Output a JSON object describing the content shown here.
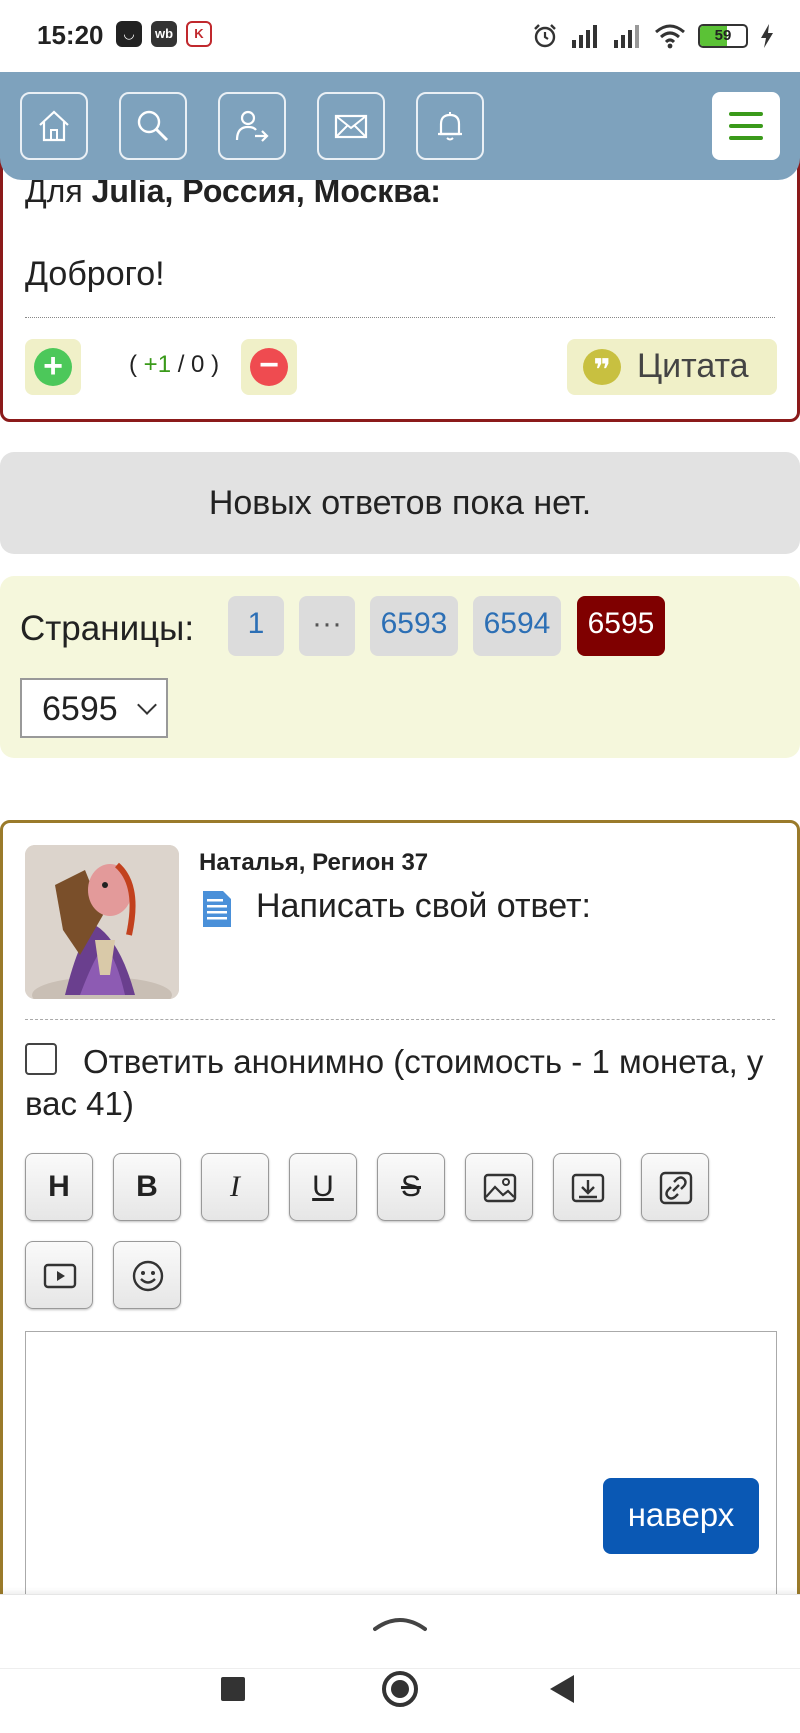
{
  "status_bar": {
    "time": "15:20",
    "app_icons": [
      "wb",
      "K"
    ],
    "battery_level": "59"
  },
  "header": {
    "nav_icons": [
      "home-icon",
      "search-icon",
      "login-icon",
      "mail-icon",
      "bell-icon"
    ],
    "menu_icon": "hamburger-menu-icon"
  },
  "post": {
    "for_prefix": "Для",
    "for_recipient": "Julia, Россия, Москва:",
    "text": "Доброго!",
    "rating_open": "(",
    "rating_plus": "+1",
    "rating_rest": "/ 0 )",
    "quote_label": "Цитата"
  },
  "no_answers": "Новых ответов пока нет.",
  "pagination": {
    "label": "Страницы:",
    "pages": [
      "1",
      "···",
      "6593",
      "6594",
      "6595"
    ],
    "current": "6595",
    "select_value": "6595"
  },
  "reply": {
    "user_name": "Наталья, Регион 37",
    "write_label": "Написать свой ответ:",
    "anonymous_label": "Ответить анонимно (стоимость - 1 монета, у вас 41)",
    "toolbar": {
      "heading": "H",
      "bold": "B",
      "italic": "I",
      "underline": "U",
      "strike": "S",
      "icons": [
        "image-icon",
        "download-icon",
        "link-icon",
        "video-icon",
        "smiley-icon"
      ]
    },
    "editor_value": ""
  },
  "scroll_top_label": "наверх",
  "colors": {
    "header_bg": "#7ea2bd",
    "post_border": "#8b1a1a",
    "reply_border": "#9a7a2a",
    "active_page": "#7f0000",
    "pager_bg": "#f5f7dc",
    "top_button": "#0a58b4"
  }
}
